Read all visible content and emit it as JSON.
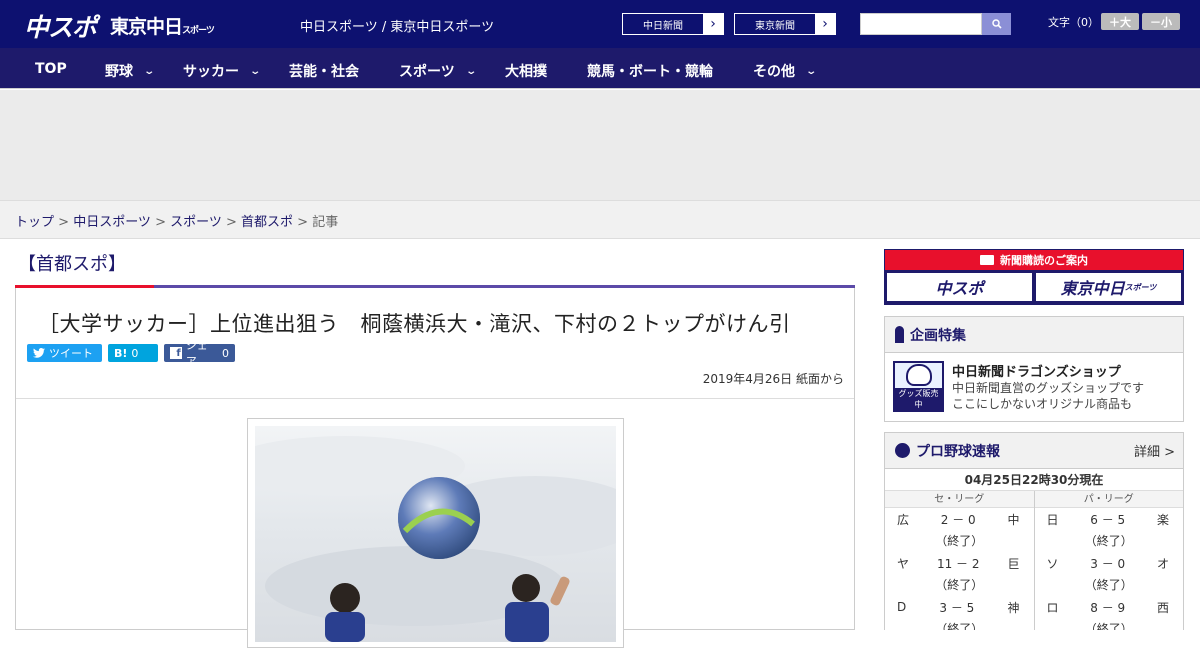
{
  "header": {
    "logo": "中スポ",
    "logo2": "東京中日",
    "logo2_small": "スポーツ",
    "site_name": "中日スポーツ / 東京中日スポーツ",
    "paper_links": [
      "中日新聞",
      "東京新聞"
    ],
    "font_size_label": "文字（0）",
    "font_up": "＋大",
    "font_down": "－小"
  },
  "nav": [
    "TOP",
    "野球",
    "サッカー",
    "芸能・社会",
    "スポーツ",
    "大相撲",
    "競馬・ボート・競輪",
    "その他"
  ],
  "breadcrumb": {
    "items": [
      "トップ",
      "中日スポーツ",
      "スポーツ",
      "首都スポ"
    ],
    "current": "記事",
    "sep": " > "
  },
  "section": "【首都スポ】",
  "article": {
    "headline": "［大学サッカー］上位進出狙う　桐蔭横浜大・滝沢、下村の２トップがけん引",
    "tweet": "ツイート",
    "hatena": "B!",
    "hatena_count": "0",
    "share": "シェア",
    "share_count": "0",
    "date": "2019年4月26日 紙面から"
  },
  "sidebar": {
    "subscribe_title": "新聞購読のご案内",
    "subscribe_btn1": "中スポ",
    "subscribe_btn2": "東京中日",
    "subscribe_btn2_small": "スポーツ",
    "special_title": "企画特集",
    "shop_tag": "グッズ販売中",
    "shop_name": "中日新聞ドラゴンズショップ",
    "shop_desc1": "中日新聞直営のグッズショップです",
    "shop_desc2": "ここにしかないオリジナル商品も",
    "baseball_title": "プロ野球速報",
    "detail": "詳細 >",
    "score_date": "04月25日22時30分現在",
    "central": {
      "name": "セ・リーグ",
      "games": [
        {
          "home": "広",
          "score": "2 － 0",
          "away": "中",
          "status": "（終了）"
        },
        {
          "home": "ヤ",
          "score": "11 － 2",
          "away": "巨",
          "status": "（終了）"
        },
        {
          "home": "D",
          "score": "3 － 5",
          "away": "神",
          "status": "（終了）"
        }
      ]
    },
    "pacific": {
      "name": "パ・リーグ",
      "games": [
        {
          "home": "日",
          "score": "6 － 5",
          "away": "楽",
          "status": "（終了）"
        },
        {
          "home": "ソ",
          "score": "3 － 0",
          "away": "オ",
          "status": "（終了）"
        },
        {
          "home": "ロ",
          "score": "8 － 9",
          "away": "西",
          "status": "（終了）"
        }
      ]
    }
  },
  "colors": {
    "header": "#0d1170",
    "nav": "#1e1a6b",
    "accent_red": "#e8102c",
    "section_line": "#5c4aa8"
  }
}
